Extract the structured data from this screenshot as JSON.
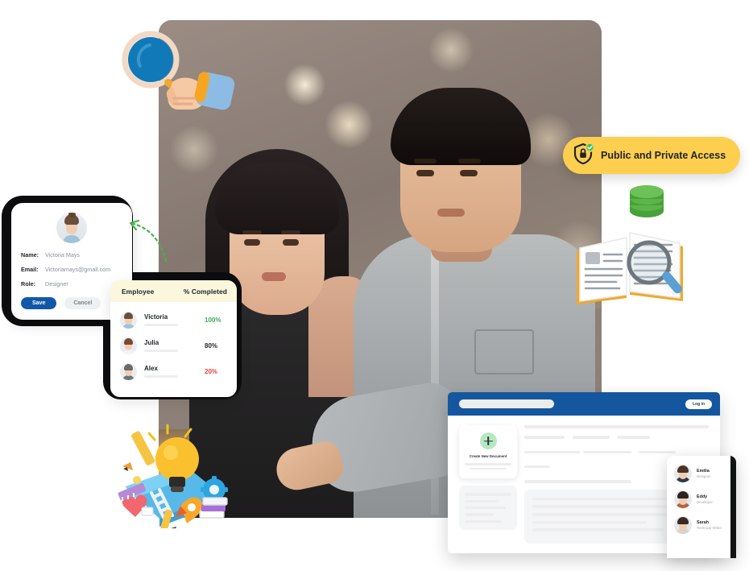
{
  "hero": {
    "photo_alt": "Two colleagues collaborating at a laptop in a cafe",
    "people": [
      "woman-colleague",
      "man-colleague"
    ]
  },
  "profile_card": {
    "avatar_name": "user-avatar",
    "fields": [
      {
        "label": "Name:",
        "value": "Victoria Mays"
      },
      {
        "label": "Email:",
        "value": "Victoriamays@gmail.com"
      },
      {
        "label": "Role:",
        "value": "Designer"
      }
    ],
    "save_label": "Save",
    "cancel_label": "Cancel",
    "save_color": "#1258a8",
    "cancel_color": "#eef0f2"
  },
  "employee_table": {
    "header_bg": "#faf7dd",
    "columns": [
      "Employee",
      "% Completed"
    ],
    "rows": [
      {
        "name": "Victoria",
        "percent": "100%",
        "color": "#3aab55",
        "hair": "#6b4f3a",
        "shirt": "#9fc2d8"
      },
      {
        "name": "Julia",
        "percent": "80%",
        "color": "#1c212a",
        "hair": "#7b4a2e",
        "shirt": "#f2f3f5"
      },
      {
        "name": "Alex",
        "percent": "20%",
        "color": "#e24141",
        "hair": "#6d6a66",
        "shirt": "#6e7479"
      }
    ]
  },
  "access_badge": {
    "label": "Public and Private Access",
    "icon": "shield-lock-icon",
    "check_icon": "check-badge-icon",
    "bg": "#fecf4f"
  },
  "decor": {
    "magnifier_hand": "hand-holding-magnifier-icon",
    "database": "green-database-icon",
    "book_search": "open-book-with-magnifier-icon",
    "creative_cluster": "creative-ideas-lightbulb-cluster-icon"
  },
  "doc_app": {
    "topbar_color": "#14579f",
    "search_placeholder": "",
    "login_label": "Log in",
    "create_label": "Create New Document",
    "plus_icon": "plus-icon",
    "accent_green": "#b6e8bf"
  },
  "people_panel": {
    "people": [
      {
        "name": "Emilia",
        "role": "Designer",
        "hair": "#4a3224",
        "shirt": "#2f3a47"
      },
      {
        "name": "Eddy",
        "role": "Developer",
        "hair": "#2e2320",
        "shirt": "#b2653c"
      },
      {
        "name": "Sarah",
        "role": "Technical Writer",
        "hair": "#3a2a22",
        "shirt": "#d8d3cc"
      }
    ]
  }
}
